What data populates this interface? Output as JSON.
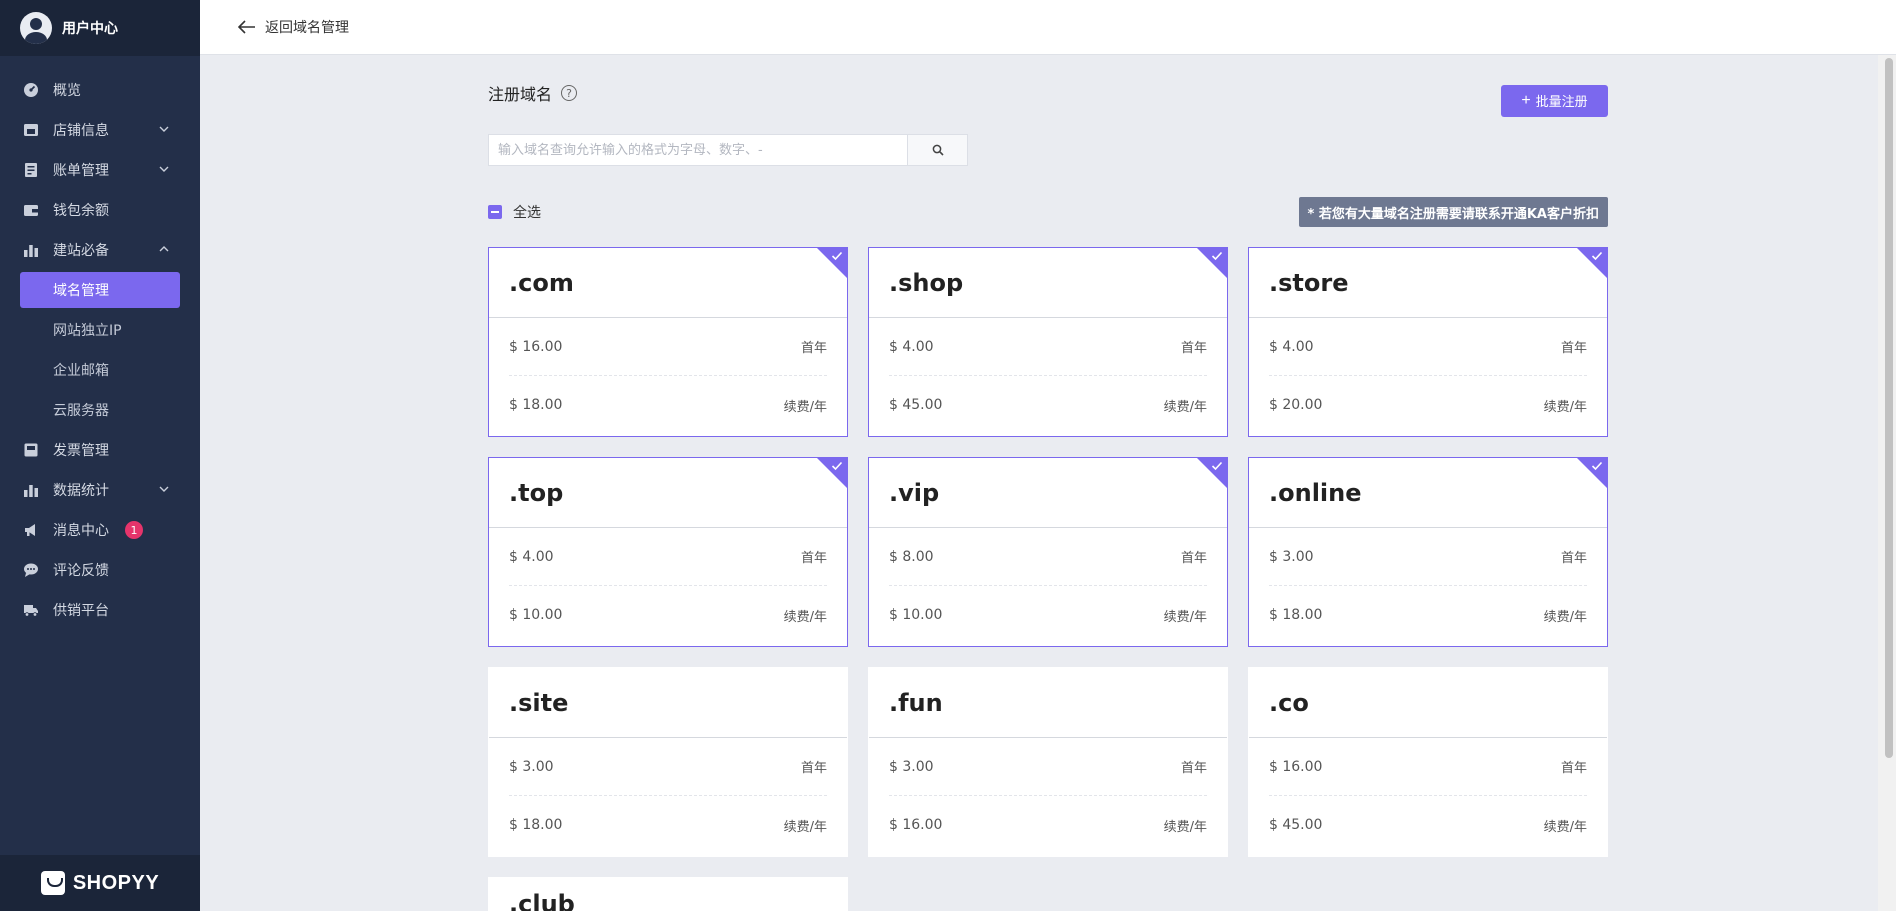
{
  "sidebar": {
    "user_title": "用户中心",
    "items": [
      {
        "label": "概览",
        "icon": "dashboard-icon"
      },
      {
        "label": "店铺信息",
        "icon": "store-icon",
        "chevron": "down"
      },
      {
        "label": "账单管理",
        "icon": "bill-icon",
        "chevron": "down"
      },
      {
        "label": "钱包余额",
        "icon": "wallet-icon"
      },
      {
        "label": "建站必备",
        "icon": "bar-chart-icon",
        "chevron": "up"
      }
    ],
    "subitems": [
      {
        "label": "域名管理",
        "active": true
      },
      {
        "label": "网站独立IP"
      },
      {
        "label": "企业邮箱"
      },
      {
        "label": "云服务器"
      }
    ],
    "items_after": [
      {
        "label": "发票管理",
        "icon": "invoice-icon"
      },
      {
        "label": "数据统计",
        "icon": "bar-chart-icon",
        "chevron": "down"
      },
      {
        "label": "消息中心",
        "icon": "megaphone-icon",
        "badge": "1"
      },
      {
        "label": "评论反馈",
        "icon": "chat-icon"
      },
      {
        "label": "供销平台",
        "icon": "truck-icon"
      }
    ],
    "logo_text": "SHOPYY",
    "accent": "#7b68ee",
    "bg": "#232f49"
  },
  "topbar": {
    "back_label": "返回域名管理"
  },
  "main": {
    "title": "注册域名",
    "help_mark": "?",
    "batch_button": "批量注册",
    "search_placeholder": "输入域名查询允许输入的格式为字母、数字、-",
    "select_all": "全选",
    "notice": "* 若您有大量域名注册需要请联系开通KA客户折扣",
    "first_year_label": "首年",
    "renew_label": "续费/年",
    "domains": [
      {
        "tld": ".com",
        "first": "$ 16.00",
        "renew": "$ 18.00",
        "selected": true
      },
      {
        "tld": ".shop",
        "first": "$ 4.00",
        "renew": "$ 45.00",
        "selected": true
      },
      {
        "tld": ".store",
        "first": "$ 4.00",
        "renew": "$ 20.00",
        "selected": true
      },
      {
        "tld": ".top",
        "first": "$ 4.00",
        "renew": "$ 10.00",
        "selected": true
      },
      {
        "tld": ".vip",
        "first": "$ 8.00",
        "renew": "$ 10.00",
        "selected": true
      },
      {
        "tld": ".online",
        "first": "$ 3.00",
        "renew": "$ 18.00",
        "selected": true
      },
      {
        "tld": ".site",
        "first": "$ 3.00",
        "renew": "$ 18.00",
        "selected": false
      },
      {
        "tld": ".fun",
        "first": "$ 3.00",
        "renew": "$ 16.00",
        "selected": false
      },
      {
        "tld": ".co",
        "first": "$ 16.00",
        "renew": "$ 45.00",
        "selected": false
      }
    ],
    "partial_card_tld": ".club"
  }
}
